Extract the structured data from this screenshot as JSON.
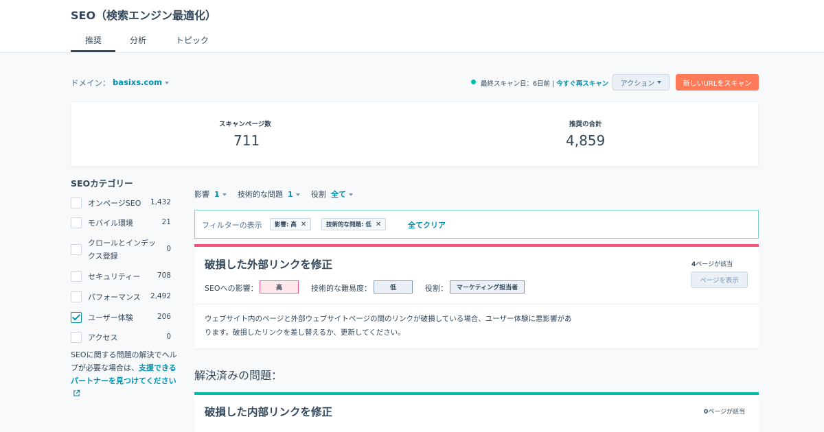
{
  "header": {
    "title": "SEO（検索エンジン最適化）",
    "tabs": [
      {
        "label": "推奨",
        "active": true
      },
      {
        "label": "分析",
        "active": false
      },
      {
        "label": "トピック",
        "active": false
      }
    ]
  },
  "toolbar": {
    "domain_label": "ドメイン：",
    "domain_value": "basixs.com",
    "scan_status": "最終スキャン日：6日前 |",
    "rescan_link": "今すぐ再スキャン",
    "action_button": "アクション",
    "scan_button": "新しいURLをスキャン",
    "status_color": "#00bda5",
    "accent_color": "#ff7a59"
  },
  "stats": {
    "scanned_label": "スキャンページ数",
    "scanned_value": "711",
    "total_label": "推奨の合計",
    "total_value": "4,859"
  },
  "sidebar": {
    "title": "SEOカテゴリー",
    "categories": [
      {
        "label": "オンページSEO",
        "count": "1,432",
        "checked": false
      },
      {
        "label": "モバイル環境",
        "count": "21",
        "checked": false
      },
      {
        "label": "クロールとインデックス登録",
        "count": "0",
        "checked": false
      },
      {
        "label": "セキュリティー",
        "count": "708",
        "checked": false
      },
      {
        "label": "パフォーマンス",
        "count": "2,492",
        "checked": false
      },
      {
        "label": "ユーザー体験",
        "count": "206",
        "checked": true
      },
      {
        "label": "アクセス",
        "count": "0",
        "checked": false
      }
    ],
    "help_text": "SEOに関する問題の解決でヘルプが必要な場合は、",
    "help_link": "支援できるパートナーを見つけてください"
  },
  "filters": {
    "impact_label": "影響",
    "impact_value": "1",
    "tech_label": "技術的な問題",
    "tech_value": "1",
    "role_label": "役割",
    "role_value": "全て",
    "active_label": "フィルターの表示",
    "chips": [
      "影響: 高",
      "技術的な問題: 低"
    ],
    "clear_all": "全てクリア"
  },
  "issue": {
    "title": "破損した外部リンクを修正",
    "page_count_num": "4",
    "page_count_text": "ページが該当",
    "view_button": "ページを表示",
    "impact_label": "SEOへの影響：",
    "impact_value": "高",
    "difficulty_label": "技術的な難易度：",
    "difficulty_value": "低",
    "role_label": "役割：",
    "role_value": "マーケティング担当者",
    "description": "ウェブサイト内のページと外部ウェブサイトページの間のリンクが破損している場合、ユーザー体験に悪影響があります。破損したリンクを差し替えるか、更新してください。",
    "bar_color": "#f2547d"
  },
  "resolved": {
    "heading": "解決済みの問題：",
    "title": "破損した内部リンクを修正",
    "page_count_num": "0",
    "page_count_text": "ページが該当",
    "bar_color": "#00bda5"
  }
}
